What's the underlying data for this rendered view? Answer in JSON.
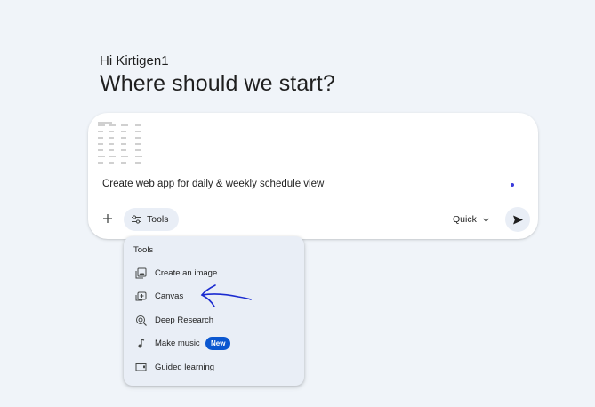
{
  "greeting": "Hi Kirtigen1",
  "headline": "Where should we start?",
  "composer": {
    "prompt_text": "Create web app for daily & weekly schedule view",
    "plus_icon": "plus-icon",
    "tools_label": "Tools",
    "tools_icon": "tune-icon",
    "mode_label": "Quick",
    "mode_icon": "chevron-down-icon",
    "send_icon": "send-icon"
  },
  "tools_menu": {
    "title": "Tools",
    "items": [
      {
        "label": "Create an image",
        "icon": "image-gallery-icon"
      },
      {
        "label": "Canvas",
        "icon": "canvas-icon"
      },
      {
        "label": "Deep Research",
        "icon": "deep-research-icon"
      },
      {
        "label": "Make music",
        "icon": "music-note-icon",
        "badge": "New"
      },
      {
        "label": "Guided learning",
        "icon": "book-icon"
      }
    ]
  },
  "colors": {
    "background": "#f0f4f9",
    "card": "#ffffff",
    "menu": "#e9eef6",
    "badge": "#0b57d0",
    "annotation": "#1b2bd0"
  }
}
